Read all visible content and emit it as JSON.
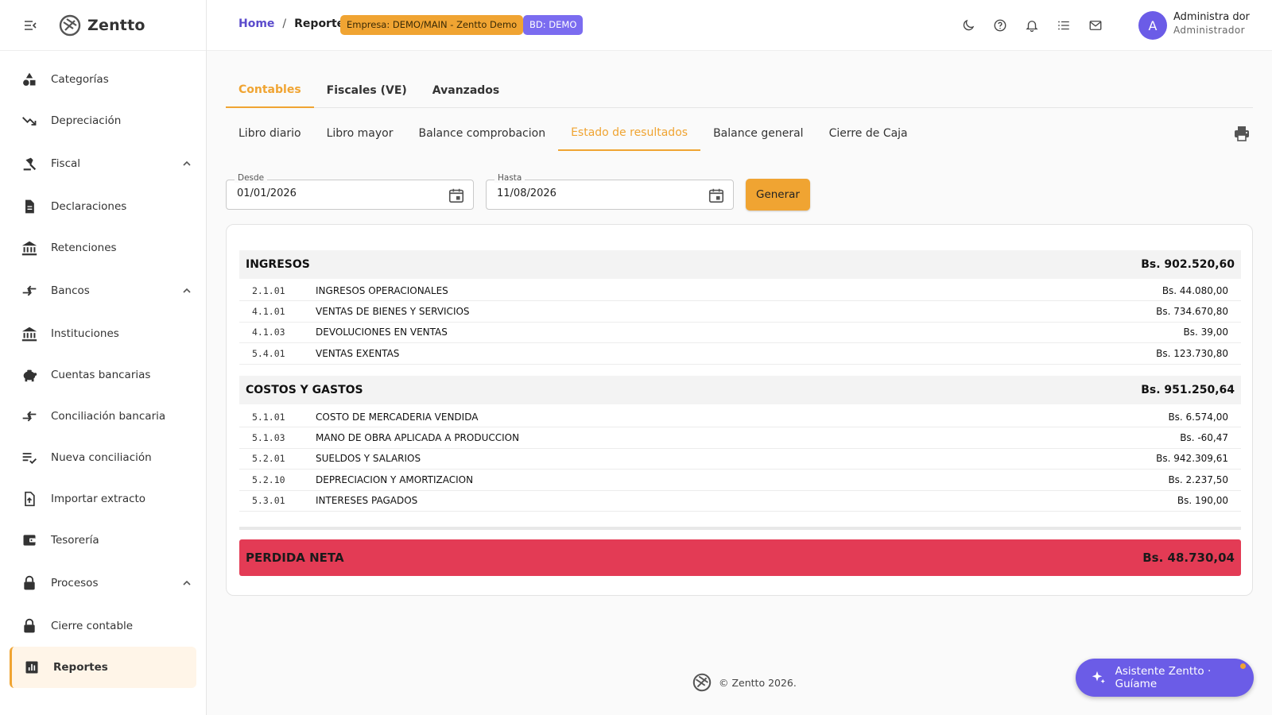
{
  "app": {
    "name": "Zentto"
  },
  "sidebar": {
    "items": [
      {
        "label": "Categorías",
        "icon": "shapes-icon"
      },
      {
        "label": "Depreciación",
        "icon": "trending-down-icon"
      },
      {
        "label": "Fiscal",
        "icon": "gavel-icon",
        "section": true
      },
      {
        "label": "Declaraciones",
        "icon": "document-icon"
      },
      {
        "label": "Retenciones",
        "icon": "bank-icon"
      },
      {
        "label": "Bancos",
        "icon": "compare-arrows-icon",
        "section": true
      },
      {
        "label": "Instituciones",
        "icon": "bank-icon"
      },
      {
        "label": "Cuentas bancarias",
        "icon": "piggy-bank-icon"
      },
      {
        "label": "Conciliación bancaria",
        "icon": "compare-arrows-icon"
      },
      {
        "label": "Nueva conciliación",
        "icon": "checklist-icon"
      },
      {
        "label": "Importar extracto",
        "icon": "file-upload-icon"
      },
      {
        "label": "Tesorería",
        "icon": "wallet-icon"
      },
      {
        "label": "Procesos",
        "icon": "lock-icon",
        "section": true
      },
      {
        "label": "Cierre contable",
        "icon": "lock-icon"
      },
      {
        "label": "Reportes",
        "icon": "bar-chart-icon",
        "active": true
      }
    ]
  },
  "header": {
    "breadcrumb": {
      "home": "Home",
      "sep": "/",
      "current": "Reportes"
    },
    "company_badge": "Empresa: DEMO/MAIN - Zentto Demo",
    "db_badge": "BD: DEMO",
    "icons": [
      "moon-icon",
      "help-icon",
      "bell-icon",
      "list-icon",
      "mail-icon"
    ],
    "avatar_letter": "A",
    "user_name": "Administra dor",
    "user_role": "Administrador"
  },
  "tabs_main": [
    "Contables",
    "Fiscales (VE)",
    "Avanzados"
  ],
  "tabs_sub": [
    "Libro diario",
    "Libro mayor",
    "Balance comprobacion",
    "Estado de resultados",
    "Balance general",
    "Cierre de Caja"
  ],
  "filters": {
    "desde_label": "Desde",
    "desde_value": "01/01/2026",
    "hasta_label": "Hasta",
    "hasta_value": "11/08/2026",
    "generate_label": "Generar"
  },
  "report": {
    "ingresos": {
      "title": "INGRESOS",
      "total": "Bs. 902.520,60",
      "rows": [
        {
          "code": "2.1.01",
          "name": "INGRESOS OPERACIONALES",
          "amount": "Bs. 44.080,00"
        },
        {
          "code": "4.1.01",
          "name": "VENTAS DE BIENES Y SERVICIOS",
          "amount": "Bs. 734.670,80"
        },
        {
          "code": "4.1.03",
          "name": "DEVOLUCIONES EN VENTAS",
          "amount": "Bs. 39,00"
        },
        {
          "code": "5.4.01",
          "name": "VENTAS EXENTAS",
          "amount": "Bs. 123.730,80"
        }
      ]
    },
    "costos": {
      "title": "COSTOS Y GASTOS",
      "total": "Bs. 951.250,64",
      "rows": [
        {
          "code": "5.1.01",
          "name": "COSTO DE MERCADERIA VENDIDA",
          "amount": "Bs. 6.574,00"
        },
        {
          "code": "5.1.03",
          "name": "MANO DE OBRA APLICADA A PRODUCCION",
          "amount": "Bs. -60,47"
        },
        {
          "code": "5.2.01",
          "name": "SUELDOS Y SALARIOS",
          "amount": "Bs. 942.309,61"
        },
        {
          "code": "5.2.10",
          "name": "DEPRECIACION Y AMORTIZACION",
          "amount": "Bs. 2.237,50"
        },
        {
          "code": "5.3.01",
          "name": "INTERESES PAGADOS",
          "amount": "Bs. 190,00"
        }
      ]
    },
    "net": {
      "label": "PERDIDA NETA",
      "amount": "Bs. 48.730,04"
    }
  },
  "footer": {
    "text": "© Zentto 2026."
  },
  "assistant": {
    "label": "Asistente Zentto · Guíame"
  },
  "colors": {
    "accent": "#f0a432",
    "primary": "#6b5ce7",
    "loss": "#e33b55"
  }
}
